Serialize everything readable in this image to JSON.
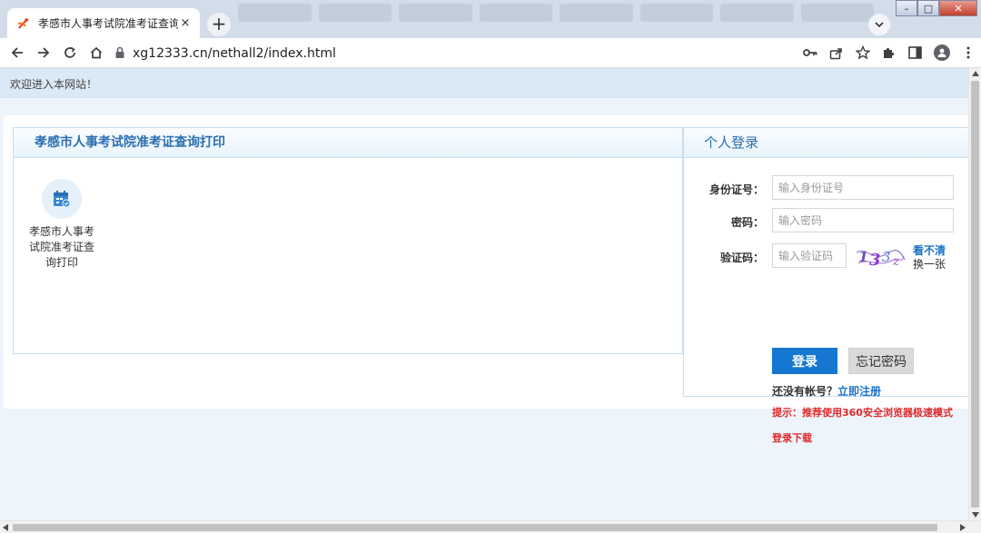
{
  "browser": {
    "tab_title": "孝感市人事考试院准考证查询打印",
    "tab_close": "×",
    "new_tab": "+",
    "url": "xg12333.cn/nethall2/index.html",
    "window_buttons": {
      "minimize": "–",
      "maximize": "□",
      "close": "✕"
    }
  },
  "page": {
    "welcome": "欢迎进入本网站！",
    "main_panel": {
      "title": "孝感市人事考试院准考证查询打印",
      "app_item": {
        "label": "孝感市人事考试院准考证查询打印",
        "icon": "calendar-check-icon"
      }
    },
    "login": {
      "title": "个人登录",
      "id_label": "身份证号：",
      "id_placeholder": "输入身份证号",
      "password_label": "密码：",
      "password_placeholder": "输入密码",
      "captcha_label": "验证码：",
      "captcha_placeholder": "输入验证码",
      "captcha_refresh": "看不清",
      "captcha_change": "换一张",
      "login_button": "登录",
      "forgot_button": "忘记密码",
      "no_account_text": "还没有帐号？",
      "register_link": "立即注册",
      "tip": "提示：推荐使用360安全浏览器极速模式",
      "download": "登录下载"
    }
  },
  "colors": {
    "accent": "#1677d2",
    "header_text": "#2b6eb1",
    "warning": "#e02a2a",
    "page_bg": "#eef4fb"
  }
}
